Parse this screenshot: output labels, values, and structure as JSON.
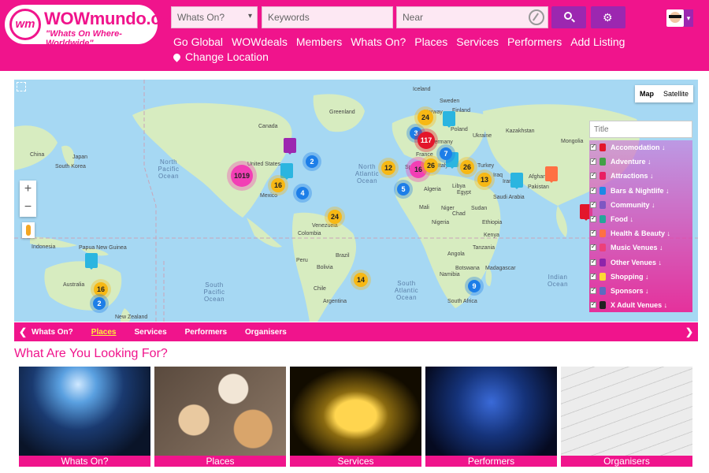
{
  "header": {
    "logo_mark": "wm",
    "logo_name": "WOWmundo.com",
    "logo_tagline": "\"Whats On Where- Worldwide\"",
    "whats_on_select": "Whats On?",
    "keywords_placeholder": "Keywords",
    "near_placeholder": "Near",
    "nav": [
      "Go Global",
      "WOWdeals",
      "Members",
      "Whats On?",
      "Places",
      "Services",
      "Performers",
      "Add Listing"
    ],
    "change_location": "Change Location"
  },
  "map": {
    "map_type": [
      "Map",
      "Satellite"
    ],
    "zoom_in": "+",
    "zoom_out": "−",
    "ocean_labels": [
      "North Pacific Ocean",
      "North Atlantic Ocean",
      "South Pacific Ocean",
      "South Atlantic Ocean",
      "Indian Ocean"
    ],
    "clusters": [
      "1019",
      "2",
      "16",
      "4",
      "24",
      "3",
      "117",
      "24",
      "12",
      "5",
      "16",
      "26",
      "7",
      "26",
      "13",
      "14",
      "9",
      "16",
      "2"
    ],
    "countries": [
      "Iceland",
      "Sweden",
      "Poland",
      "Ukraine",
      "Kazakhstan",
      "Mongolia",
      "Turkey",
      "Iraq",
      "Iran",
      "Afghanistan",
      "Pakistan",
      "Egypt",
      "Libya",
      "Algeria",
      "Mali",
      "Niger",
      "Chad",
      "Sudan",
      "Nigeria",
      "Ethiopia",
      "Kenya",
      "Tanzania",
      "Angola",
      "Namibia",
      "Botswana",
      "Madagascar",
      "South Africa",
      "Saudi Arabia",
      "Canada",
      "United States",
      "Mexico",
      "Venezuela",
      "Colombia",
      "Peru",
      "Brazil",
      "Bolivia",
      "Chile",
      "Argentina",
      "Australia",
      "New Zealand",
      "Indonesia",
      "Papua New Guinea",
      "South Korea",
      "China",
      "Japan",
      "Greenland",
      "Spain",
      "Germany",
      "France",
      "Italy",
      "Norway",
      "Finland"
    ]
  },
  "filter": {
    "title_placeholder": "Title",
    "categories": [
      {
        "label": "Accomodation ↓",
        "color": "#e3162b"
      },
      {
        "label": "Adventure ↓",
        "color": "#43a047"
      },
      {
        "label": "Attractions ↓",
        "color": "#e91e63"
      },
      {
        "label": "Bars & Nightlife ↓",
        "color": "#1e88e5"
      },
      {
        "label": "Community ↓",
        "color": "#7e57c2"
      },
      {
        "label": "Food ↓",
        "color": "#26a69a"
      },
      {
        "label": "Health & Beauty ↓",
        "color": "#ff7043"
      },
      {
        "label": "Music Venues ↓",
        "color": "#ec407a"
      },
      {
        "label": "Other Venues ↓",
        "color": "#8e24aa"
      },
      {
        "label": "Shopping ↓",
        "color": "#fdd835"
      },
      {
        "label": "Sponsors ↓",
        "color": "#5c6bc0"
      },
      {
        "label": "X Adult Venues ↓",
        "color": "#212121"
      }
    ]
  },
  "tabs": {
    "left_arrow": "❮",
    "right_arrow": "❯",
    "items": [
      "Whats On?",
      "Places",
      "Services",
      "Performers",
      "Organisers"
    ],
    "active": "Places"
  },
  "section_title": "What Are You Looking For?",
  "cards": [
    {
      "label": "Whats On?",
      "image": "concert-crowd"
    },
    {
      "label": "Places",
      "image": "food-table"
    },
    {
      "label": "Services",
      "image": "taxi-sign"
    },
    {
      "label": "Performers",
      "image": "guitarist"
    },
    {
      "label": "Organisers",
      "image": "calendar-page"
    }
  ],
  "colors": {
    "brand_pink": "#f0148c",
    "button_purple": "#9c27b0",
    "tab_active": "#ffeb3b"
  }
}
